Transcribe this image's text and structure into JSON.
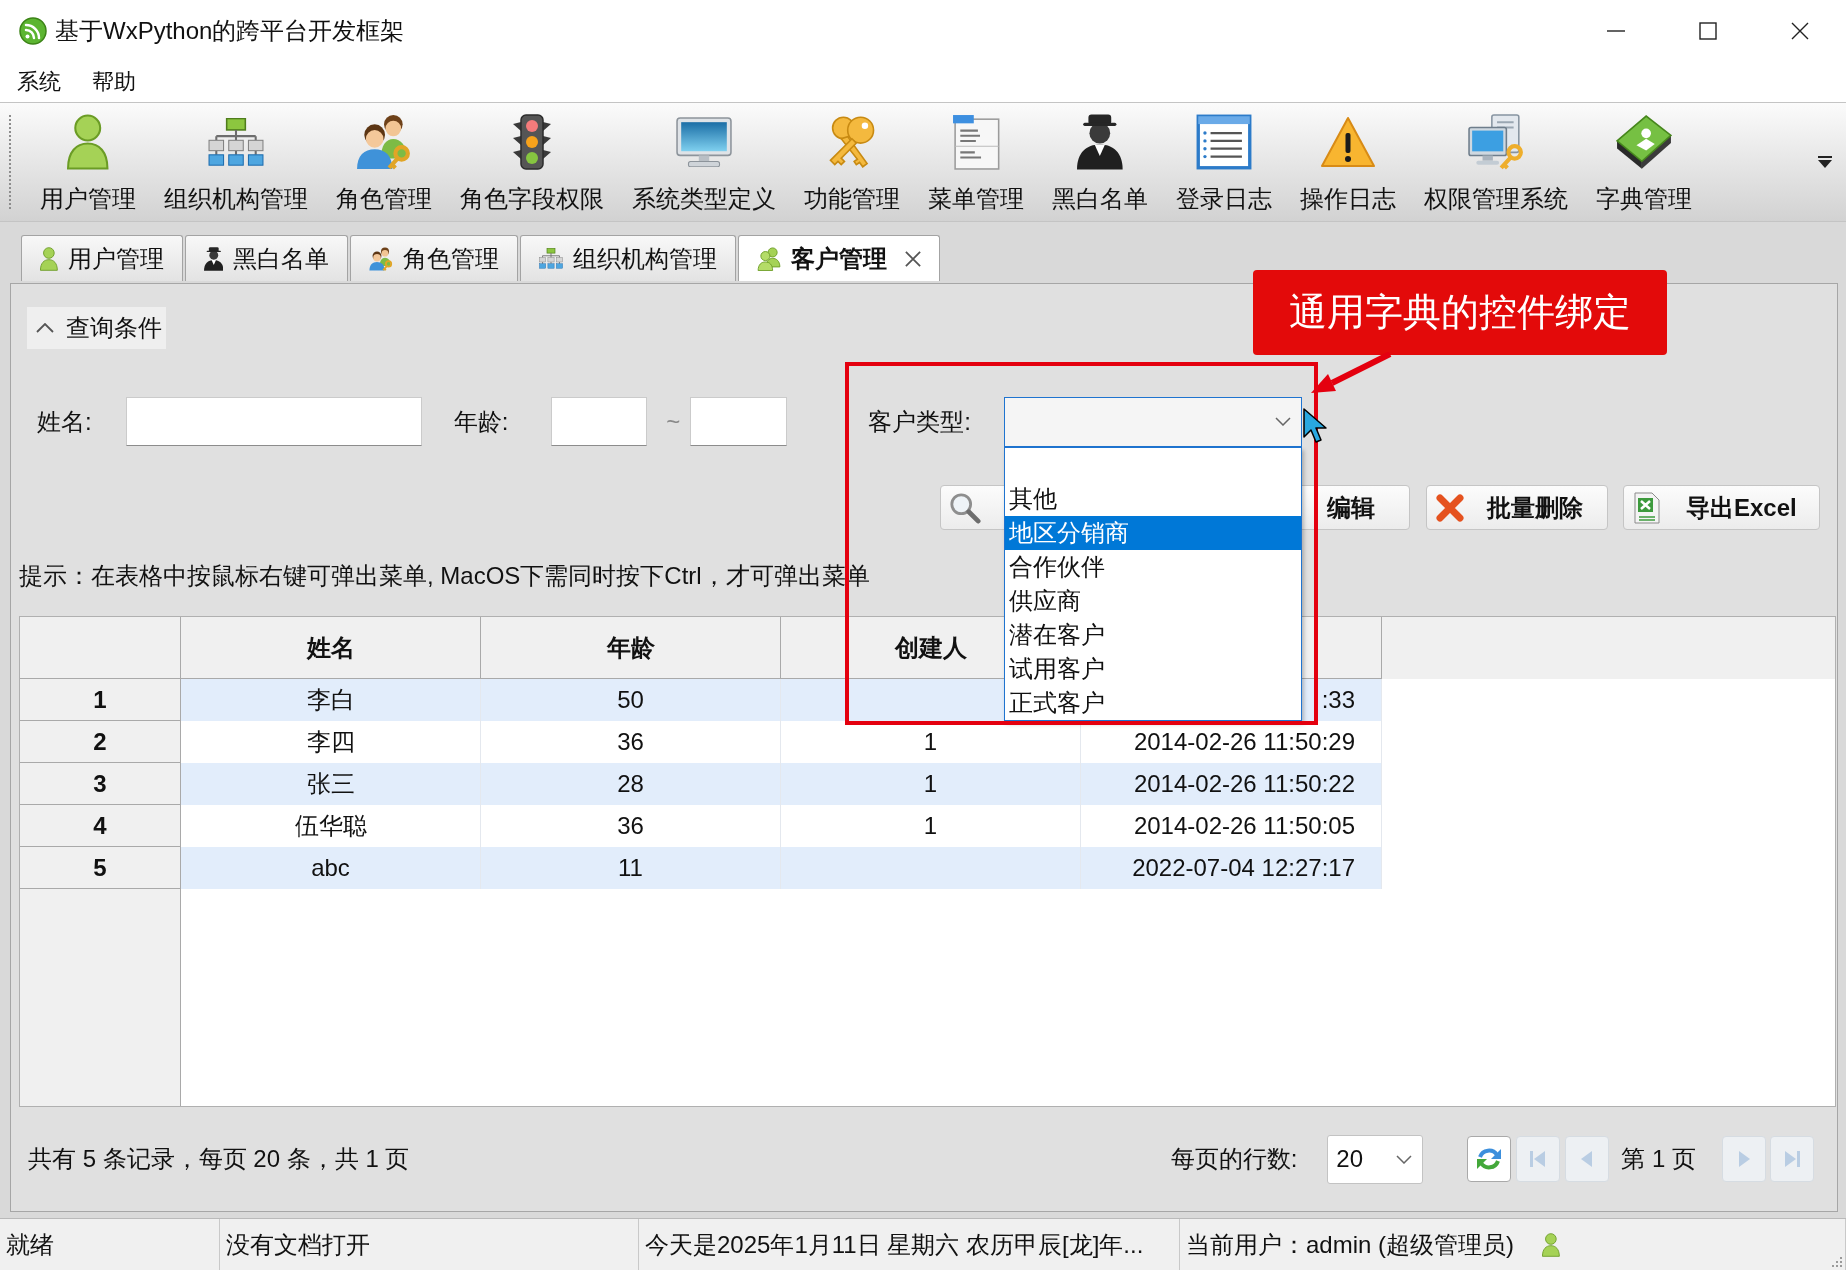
{
  "window": {
    "title": "基于WxPython的跨平台开发框架"
  },
  "menu": [
    "系统",
    "帮助"
  ],
  "toolbar": [
    "用户管理",
    "组织机构管理",
    "角色管理",
    "角色字段权限",
    "系统类型定义",
    "功能管理",
    "菜单管理",
    "黑白名单",
    "登录日志",
    "操作日志",
    "权限管理系统",
    "字典管理"
  ],
  "tabs": [
    {
      "label": "用户管理",
      "selected": false
    },
    {
      "label": "黑白名单",
      "selected": false
    },
    {
      "label": "角色管理",
      "selected": false
    },
    {
      "label": "组织机构管理",
      "selected": false
    },
    {
      "label": "客户管理",
      "selected": true
    }
  ],
  "query_panel": {
    "title": "查询条件",
    "expanded": true,
    "fields": [
      {
        "kind": "text",
        "label": "姓名:"
      },
      {
        "kind": "range",
        "label": "年龄:",
        "separator": "~"
      },
      {
        "kind": "combo",
        "label": "客户类型:",
        "open": true,
        "options": [
          {
            "label": "其他",
            "selected": false
          },
          {
            "label": "地区分销商",
            "selected": true
          },
          {
            "label": "合作伙伴",
            "selected": false
          },
          {
            "label": "供应商",
            "selected": false
          },
          {
            "label": "潜在客户",
            "selected": false
          },
          {
            "label": "试用客户",
            "selected": false
          },
          {
            "label": "正式客户",
            "selected": false
          }
        ]
      }
    ]
  },
  "buttons": [
    {
      "kind": "search"
    },
    {
      "kind": "edit",
      "label": "编辑"
    },
    {
      "kind": "delete",
      "label": "批量删除"
    },
    {
      "kind": "export",
      "label": "导出Excel"
    }
  ],
  "hint": "提示：在表格中按鼠标右键可弹出菜单, MacOS下需同时按下Ctrl，才可弹出菜单",
  "table": {
    "columns": [
      "姓名",
      "年龄",
      "创建人"
    ],
    "rows": [
      {
        "number": "1",
        "name": "李白",
        "age": "50",
        "column_5": ":33"
      },
      {
        "number": "2",
        "name": "李四",
        "age": "36",
        "creator": "1",
        "column_5": "2014-02-26 11:50:29"
      },
      {
        "number": "3",
        "name": "张三",
        "age": "28",
        "creator": "1",
        "column_5": "2014-02-26 11:50:22"
      },
      {
        "number": "4",
        "name": "伍华聪",
        "age": "36",
        "creator": "1",
        "column_5": "2014-02-26 11:50:05"
      },
      {
        "number": "5",
        "name": "abc",
        "age": "11",
        "column_5": "2022-07-04 12:27:17"
      }
    ]
  },
  "pagination": {
    "summary": "共有 5 条记录，每页 20 条，共 1 页",
    "rows_per_page_label": "每页的行数:",
    "rows_per_page": "20",
    "nav_left": [
      {
        "kind": "refresh",
        "disabled": false
      },
      {
        "kind": "first",
        "disabled": true
      },
      {
        "kind": "previous",
        "disabled": true
      }
    ],
    "page": "第 1 页",
    "nav_right": [
      {
        "kind": "next",
        "disabled": true
      },
      {
        "kind": "last",
        "disabled": true
      }
    ]
  },
  "status_bar": [
    {
      "text": "就绪"
    },
    {
      "text": "没有文档打开"
    },
    {
      "text": "今天是2025年1月11日 星期六 农历甲辰[龙]年..."
    },
    {
      "text": "当前用户：admin (超级管理员)"
    }
  ],
  "annotation": {
    "text": "通用字典的控件绑定"
  }
}
